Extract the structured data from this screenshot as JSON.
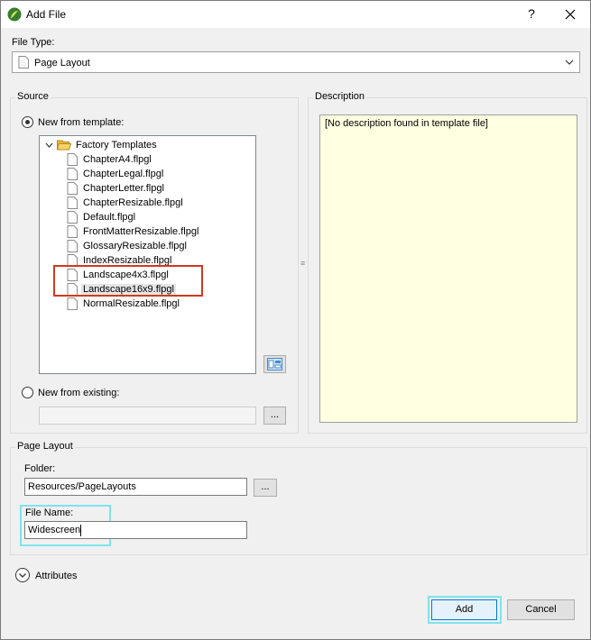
{
  "window": {
    "title": "Add File",
    "help_glyph": "?"
  },
  "file_type": {
    "label": "File Type:",
    "value": "Page Layout"
  },
  "source": {
    "group_title": "Source",
    "new_from_template_label": "New from template:",
    "tree_root": "Factory Templates",
    "templates": [
      "ChapterA4.flpgl",
      "ChapterLegal.flpgl",
      "ChapterLetter.flpgl",
      "ChapterResizable.flpgl",
      "Default.flpgl",
      "FrontMatterResizable.flpgl",
      "GlossaryResizable.flpgl",
      "IndexResizable.flpgl",
      "Landscape4x3.flpgl",
      "Landscape16x9.flpgl",
      "NormalResizable.flpgl"
    ],
    "selected_template": "Landscape16x9.flpgl",
    "new_from_existing_label": "New from existing:",
    "existing_value": "",
    "browse_label": "..."
  },
  "description": {
    "group_title": "Description",
    "text": "[No description found in template file]"
  },
  "page_layout": {
    "group_title": "Page Layout",
    "folder_label": "Folder:",
    "folder_value": "Resources/PageLayouts",
    "folder_browse_label": "...",
    "file_name_label": "File Name:",
    "file_name_value": "Widescreen"
  },
  "attributes": {
    "label": "Attributes"
  },
  "footer": {
    "add_label": "Add",
    "cancel_label": "Cancel"
  },
  "colors": {
    "highlight_red": "#d03a1e",
    "highlight_cyan": "#7fe3ec",
    "description_bg": "#ffffe1",
    "folder_yellow": "#f5c542"
  }
}
